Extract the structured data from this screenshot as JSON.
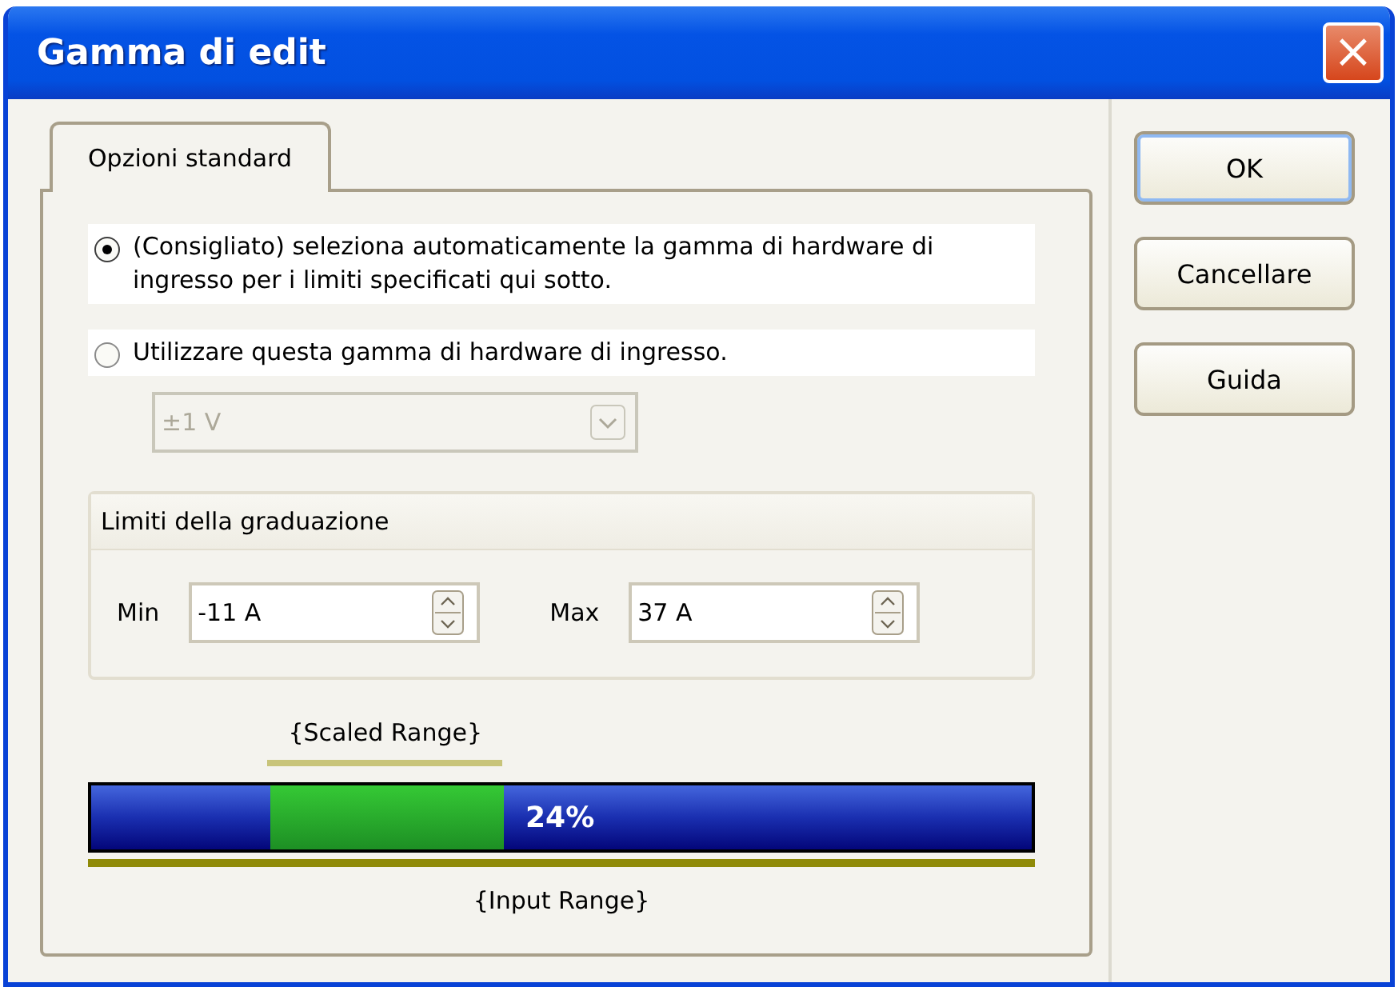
{
  "window": {
    "title": "Gamma di edit",
    "close": "×"
  },
  "tabs": [
    {
      "label": "Opzioni standard",
      "selected": true
    }
  ],
  "options": [
    {
      "label": "(Consigliato) seleziona automaticamente la gamma di hardware di ingresso per i limiti specificati qui sotto.",
      "selected": true
    },
    {
      "label": "Utilizzare questa gamma di hardware di ingresso.",
      "selected": false
    }
  ],
  "range_dropdown": {
    "value": "±1 V",
    "disabled": true
  },
  "scale_limits": {
    "title": "Limiti della graduazione",
    "fields": [
      {
        "label": "Min",
        "value": "-11 A"
      },
      {
        "label": "Max",
        "value": "37 A"
      }
    ]
  },
  "range_bar": {
    "scaled_label": "{Scaled Range}",
    "level": 0.248,
    "percent": "24%",
    "input_label": "{Input Range}"
  },
  "buttons": [
    {
      "label": "OK",
      "default": true
    },
    {
      "label": "Cancellare",
      "default": false
    },
    {
      "label": "Guida",
      "default": false
    }
  ]
}
